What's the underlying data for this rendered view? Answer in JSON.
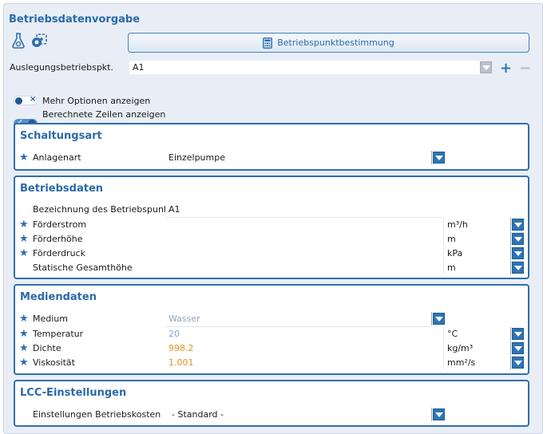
{
  "header": {
    "title": "Betriebsdatenvorgabe",
    "operating_point_button": "Betriebspunktbestimmung"
  },
  "design_point": {
    "label": "Auslegungsbetriebspkt.",
    "value": "A1"
  },
  "options": {
    "more_options_label": "Mehr Optionen anzeigen",
    "more_options_on": false,
    "calculated_rows_label": "Berechnete Zeilen anzeigen",
    "calculated_rows_on": true
  },
  "schaltungsart": {
    "title": "Schaltungsart",
    "anlagenart_label": "Anlagenart",
    "anlagenart_value": "Einzelpumpe"
  },
  "betriebsdaten": {
    "title": "Betriebsdaten",
    "rows": [
      {
        "label": "Bezeichnung des Betriebspunktes",
        "value": "A1",
        "unit": "",
        "starred": false
      },
      {
        "label": "Förderstrom",
        "value": "",
        "unit": "m³/h",
        "starred": true
      },
      {
        "label": "Förderhöhe",
        "value": "",
        "unit": "m",
        "starred": true
      },
      {
        "label": "Förderdruck",
        "value": "",
        "unit": "kPa",
        "starred": true
      },
      {
        "label": "Statische Gesamthöhe",
        "value": "",
        "unit": "m",
        "starred": false
      }
    ]
  },
  "mediendaten": {
    "title": "Mediendaten",
    "medium_label": "Medium",
    "medium_value": "Wasser",
    "rows": [
      {
        "label": "Temperatur",
        "value": "20",
        "unit": "°C",
        "value_color": "#7fa6cf"
      },
      {
        "label": "Dichte",
        "value": "998.2",
        "unit": "kg/m³",
        "value_color": "#e0902a"
      },
      {
        "label": "Viskosität",
        "value": "1.001",
        "unit": "mm²/s",
        "value_color": "#e0902a"
      }
    ]
  },
  "lcc": {
    "title": "LCC-Einstellungen",
    "betriebskosten_label": "Einstellungen Betriebskosten",
    "betriebskosten_value": "- Standard -"
  },
  "colors": {
    "accent": "#2f6fae",
    "title_blue": "#2a6aa8",
    "panel_bg": "#e9eef6"
  }
}
